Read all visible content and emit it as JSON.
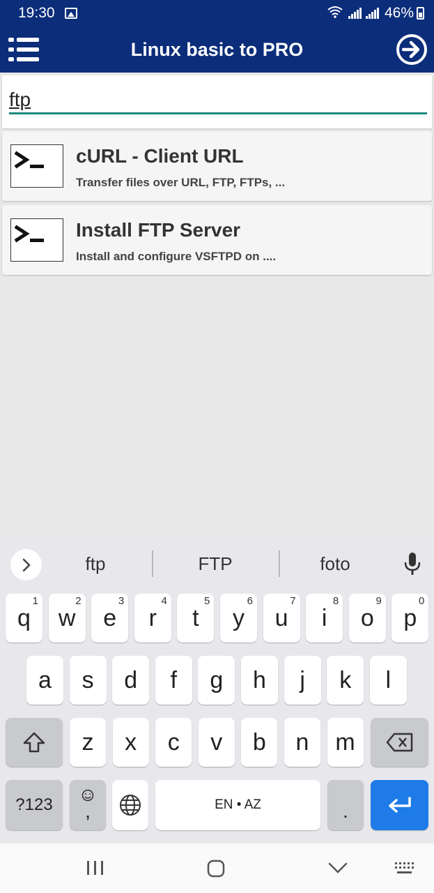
{
  "status": {
    "time": "19:30",
    "battery": "46%"
  },
  "appbar": {
    "title": "Linux basic to PRO"
  },
  "search": {
    "value": "ftp"
  },
  "results": [
    {
      "title": "cURL - Client URL",
      "subtitle": "Transfer files over URL, FTP, FTPs, ..."
    },
    {
      "title": "Install FTP Server",
      "subtitle": "Install and configure VSFTPD on ...."
    }
  ],
  "keyboard": {
    "suggestions": [
      "ftp",
      "FTP",
      "foto"
    ],
    "row1": [
      {
        "k": "q",
        "n": "1"
      },
      {
        "k": "w",
        "n": "2"
      },
      {
        "k": "e",
        "n": "3"
      },
      {
        "k": "r",
        "n": "4"
      },
      {
        "k": "t",
        "n": "5"
      },
      {
        "k": "y",
        "n": "6"
      },
      {
        "k": "u",
        "n": "7"
      },
      {
        "k": "i",
        "n": "8"
      },
      {
        "k": "o",
        "n": "9"
      },
      {
        "k": "p",
        "n": "0"
      }
    ],
    "row2": [
      "a",
      "s",
      "d",
      "f",
      "g",
      "h",
      "j",
      "k",
      "l"
    ],
    "row3": [
      "z",
      "x",
      "c",
      "v",
      "b",
      "n",
      "m"
    ],
    "symbols_label": "?123",
    "comma_label": ",",
    "space_label": "EN • AZ",
    "period_label": ".",
    "accent_color": "#1e7be8"
  }
}
